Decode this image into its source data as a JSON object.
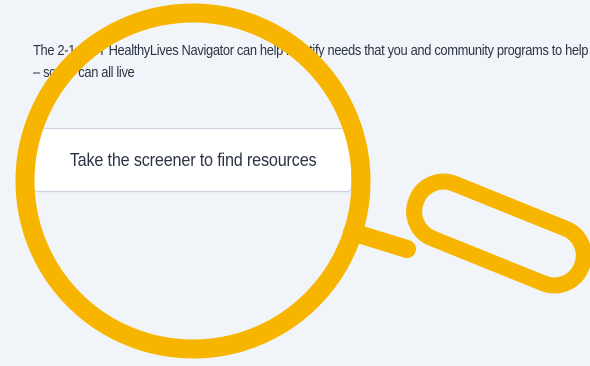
{
  "intro": {
    "text": "The 2-1-1 CT HealthyLives Navigator can help identify needs that you and community programs to help with those needs – so we can all live"
  },
  "screener_button": {
    "label": "Take the screener to find resources"
  },
  "colors": {
    "page_background": "#f1f4f8",
    "text": "#2b3444",
    "button_border": "#c9d3df",
    "magnifier": "#f7b500"
  },
  "decorations": {
    "magnifier": "magnifying-glass-icon"
  }
}
